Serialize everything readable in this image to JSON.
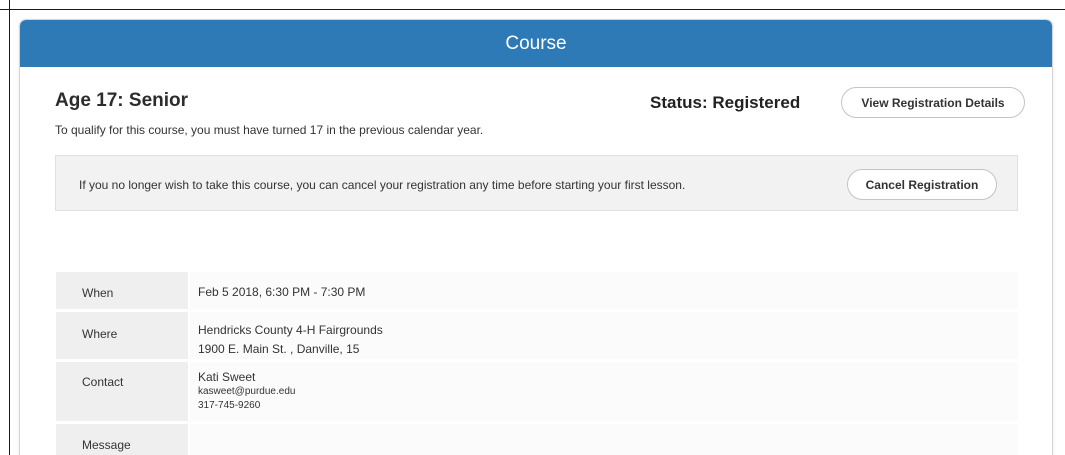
{
  "header": {
    "title": "Course"
  },
  "course": {
    "title": "Age 17: Senior",
    "description": "To qualify for this course, you must have turned 17 in the previous calendar year."
  },
  "status": {
    "text": "Status: Registered",
    "view_details_label": "View Registration Details"
  },
  "notice": {
    "text": "If you no longer wish to take this course, you can cancel your registration any time before starting your first lesson.",
    "cancel_label": "Cancel Registration"
  },
  "details": {
    "when_label": "When",
    "when_value": "Feb 5 2018, 6:30 PM - 7:30 PM",
    "where_label": "Where",
    "where_line1": "Hendricks County 4-H Fairgrounds",
    "where_line2": "1900 E. Main St. , Danville, 15",
    "contact_label": "Contact",
    "contact_name": "Kati Sweet",
    "contact_email": "kasweet@purdue.edu",
    "contact_phone": "317-745-9260",
    "message_label": "Message",
    "message_value": ""
  }
}
